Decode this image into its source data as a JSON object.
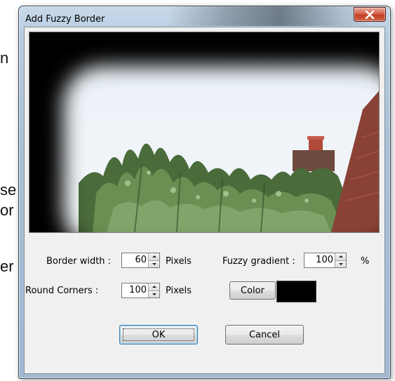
{
  "background_fragments": [
    "n",
    "se",
    "or",
    "er"
  ],
  "dialog": {
    "title": "Add Fuzzy Border",
    "close_glyph": "close-icon",
    "border_width": {
      "label": "Border width :",
      "value": "60",
      "unit": "Pixels"
    },
    "fuzzy_gradient": {
      "label": "Fuzzy gradient :",
      "value": "100",
      "unit": "%"
    },
    "round_corners": {
      "label": "Round Corners :",
      "value": "100",
      "unit": "Pixels"
    },
    "color_button_label": "Color",
    "selected_color": "#000000",
    "ok_label": "OK",
    "cancel_label": "Cancel"
  },
  "colors": {
    "close_button": "#c9452c",
    "window_frame": "#aac0d6",
    "client_bg": "#f0f0f0"
  }
}
